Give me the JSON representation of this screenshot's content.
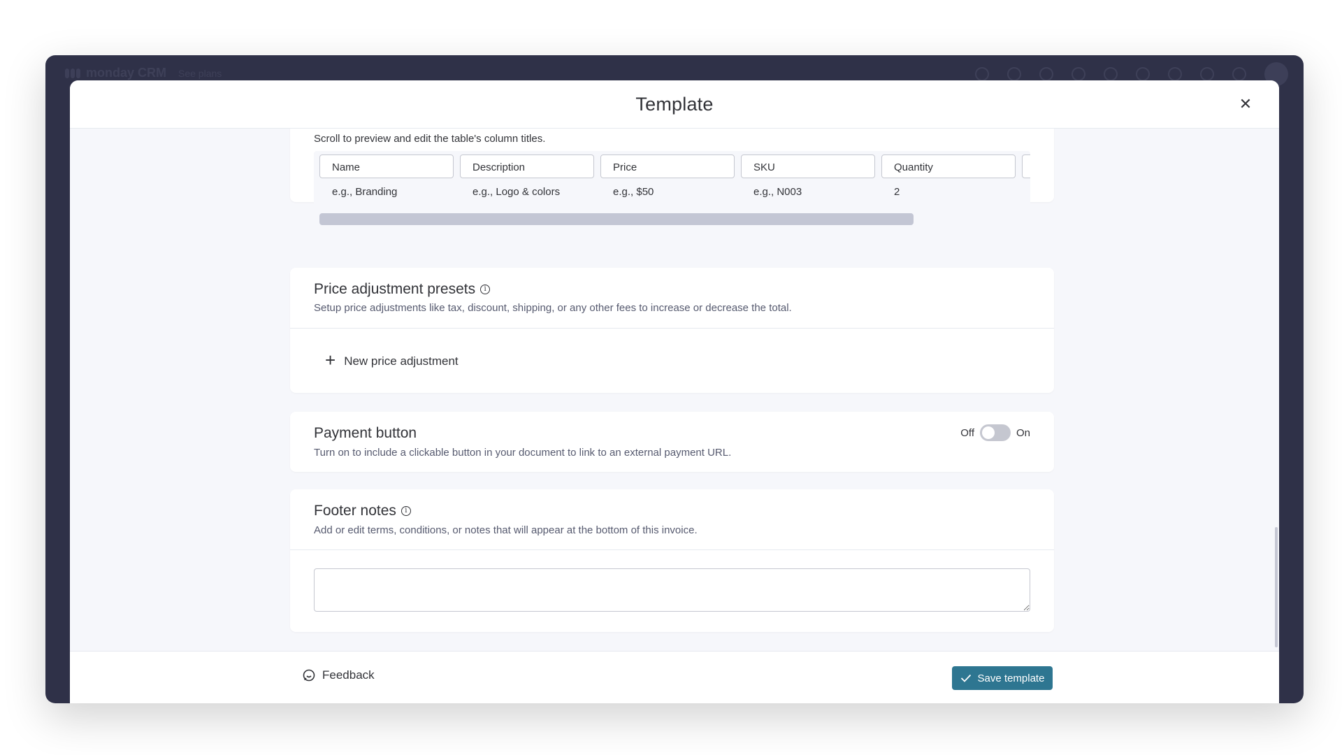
{
  "app": {
    "brand": "monday CRM",
    "plans_label": "See plans"
  },
  "modal": {
    "title": "Template",
    "close_icon": "close-icon"
  },
  "table_section": {
    "hint": "Scroll to preview and edit the table's column titles.",
    "columns": [
      "Name",
      "Description",
      "Price",
      "SKU",
      "Quantity"
    ],
    "example_row": [
      "e.g., Branding",
      "e.g., Logo & colors",
      "e.g., $50",
      "e.g., N003",
      "2"
    ]
  },
  "price_adjustments": {
    "title": "Price adjustment presets",
    "description": "Setup price adjustments like tax, discount, shipping, or any other fees to increase or decrease the total.",
    "add_label": "New price adjustment"
  },
  "payment_button": {
    "title": "Payment button",
    "description": "Turn on to include a clickable button in your document to link to an external payment URL.",
    "off_label": "Off",
    "on_label": "On",
    "enabled": false
  },
  "footer_notes": {
    "title": "Footer notes",
    "description": "Add or edit terms, conditions, or notes that will appear at the bottom of this invoice.",
    "value": ""
  },
  "footer": {
    "feedback_label": "Feedback",
    "save_label": "Save template"
  },
  "colors": {
    "accent": "#2e7691",
    "app_background": "#2f3148",
    "panel_background": "#f6f7fb"
  }
}
